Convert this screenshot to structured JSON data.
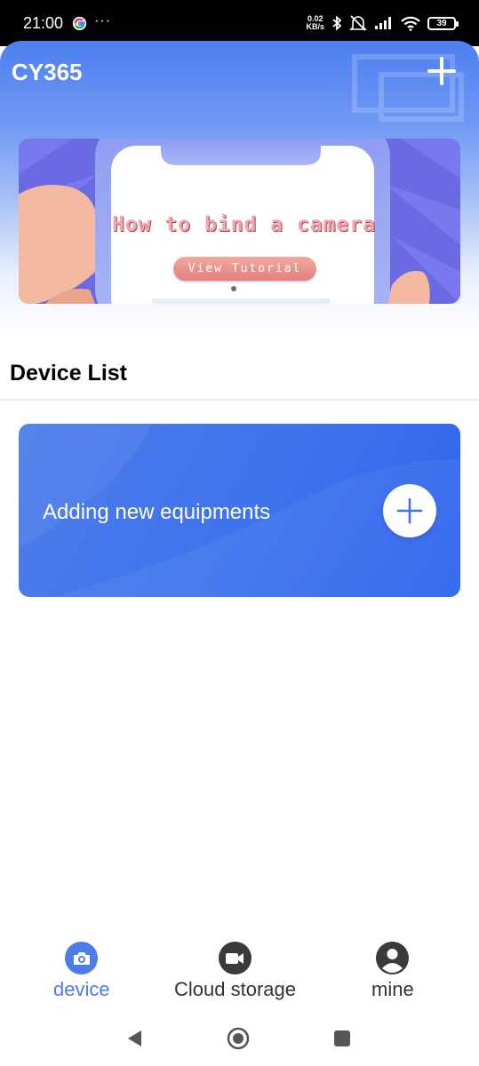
{
  "status_bar": {
    "time": "21:00",
    "more": "···",
    "net_speed_value": "0.02",
    "net_speed_unit": "KB/s",
    "battery": "39",
    "icons": [
      "google-icon",
      "bluetooth-icon",
      "vibrate-off-icon",
      "signal-icon",
      "wifi-icon",
      "battery-icon"
    ]
  },
  "header": {
    "title": "CY365",
    "add_icon": "plus-icon"
  },
  "banner": {
    "title": "How to bind a camera",
    "button_label": "View Tutorial"
  },
  "device_list": {
    "title": "Device List",
    "add_card_label": "Adding new equipments",
    "add_icon": "plus-icon"
  },
  "bottom_nav": {
    "items": [
      {
        "label": "device",
        "icon": "camera-icon",
        "active": true
      },
      {
        "label": "Cloud storage",
        "icon": "video-icon",
        "active": false
      },
      {
        "label": "mine",
        "icon": "person-icon",
        "active": false
      }
    ]
  },
  "system_nav": {
    "icons": [
      "back-icon",
      "home-icon",
      "recents-icon"
    ]
  },
  "colors": {
    "accent": "#4d7bea",
    "card_blue": "#3e73ee",
    "banner_purple": "#6e6ee6",
    "banner_pink": "#f3a3ad"
  }
}
